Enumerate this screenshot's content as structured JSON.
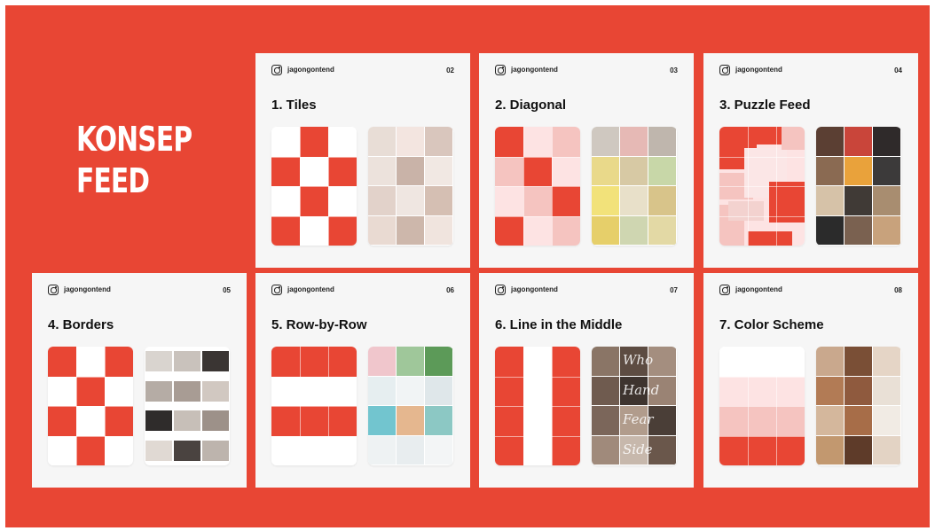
{
  "page_title": {
    "line1": "KONSEP",
    "line2": "FEED"
  },
  "colors": {
    "background": "#e84634",
    "card": "#f6f6f6",
    "accent": "#e84634"
  },
  "cards": [
    {
      "handle": "jagongontend",
      "page_number": "02",
      "title": "1. Tiles",
      "icon": "instagram-icon"
    },
    {
      "handle": "jagongontend",
      "page_number": "03",
      "title": "2. Diagonal",
      "icon": "instagram-icon"
    },
    {
      "handle": "jagongontend",
      "page_number": "04",
      "title": "3. Puzzle Feed",
      "icon": "instagram-icon"
    },
    {
      "handle": "jagongontend",
      "page_number": "05",
      "title": "4. Borders",
      "icon": "instagram-icon"
    },
    {
      "handle": "jagongontend",
      "page_number": "06",
      "title": "5. Row-by-Row",
      "icon": "instagram-icon"
    },
    {
      "handle": "jagongontend",
      "page_number": "07",
      "title": "6. Line in the Middle",
      "icon": "instagram-icon"
    },
    {
      "handle": "jagongontend",
      "page_number": "08",
      "title": "7. Color Scheme",
      "icon": "instagram-icon"
    }
  ],
  "middle_line_words": [
    "Who",
    "Hand",
    "Fear",
    "Side"
  ]
}
